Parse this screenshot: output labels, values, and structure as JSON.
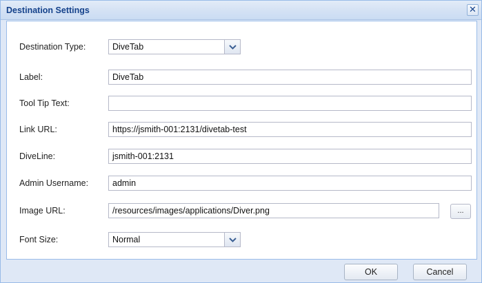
{
  "dialog": {
    "title": "Destination Settings",
    "close_glyph": "✕"
  },
  "form": {
    "destination_type": {
      "label": "Destination Type:",
      "value": "DiveTab"
    },
    "label_field": {
      "label": "Label:",
      "value": "DiveTab"
    },
    "tooltip": {
      "label": "Tool Tip Text:",
      "value": ""
    },
    "link_url": {
      "label": "Link URL:",
      "value": "https://jsmith-001:2131/divetab-test"
    },
    "diveline": {
      "label": "DiveLine:",
      "value": "jsmith-001:2131"
    },
    "admin_username": {
      "label": "Admin Username:",
      "value": "admin"
    },
    "image_url": {
      "label": "Image URL:",
      "value": "/resources/images/applications/Diver.png",
      "browse_label": "..."
    },
    "font_size": {
      "label": "Font Size:",
      "value": "Normal"
    }
  },
  "footer": {
    "ok_label": "OK",
    "cancel_label": "Cancel"
  },
  "icons": {
    "close": "close-icon",
    "dropdown": "chevron-down-icon"
  },
  "colors": {
    "title_text": "#15428b",
    "border": "#99bbe8",
    "background": "#dfe8f6"
  }
}
